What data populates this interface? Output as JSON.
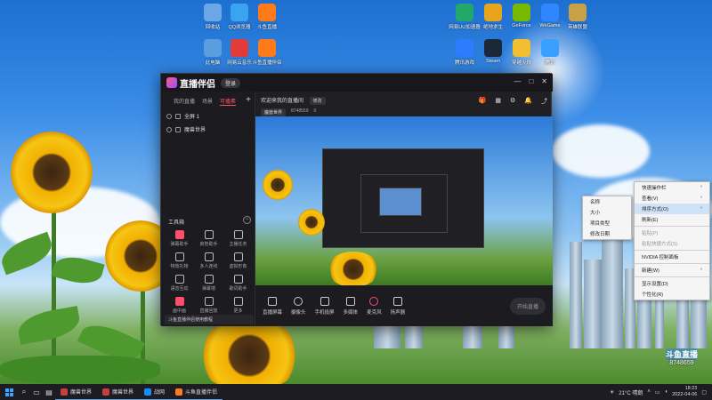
{
  "desktop": {
    "icons_left": [
      {
        "label": "回收站",
        "color": "#6ba6e6"
      },
      {
        "label": "QQ浏览器",
        "color": "#3ba4f0"
      },
      {
        "label": "斗鱼直播",
        "color": "#ff7a1a"
      },
      {
        "label": "此电脑",
        "color": "#5b9ee0"
      },
      {
        "label": "网易云音乐",
        "color": "#e33a3a"
      },
      {
        "label": "斗鱼直播伴侣",
        "color": "#ff7a1a"
      }
    ],
    "icons_right": [
      {
        "label": "网易UU加速器",
        "color": "#22a86a"
      },
      {
        "label": "绝地求生",
        "color": "#e6a51a"
      },
      {
        "label": "GeForce",
        "color": "#76b900"
      },
      {
        "label": "WeGame",
        "color": "#2f86ff"
      },
      {
        "label": "英雄联盟",
        "color": "#c8a046"
      },
      {
        "label": "腾讯游戏",
        "color": "#2b7cff"
      },
      {
        "label": "Steam",
        "color": "#1b2838"
      },
      {
        "label": "穿越火线",
        "color": "#f0c030"
      },
      {
        "label": "腾讯",
        "color": "#39a0ff"
      }
    ]
  },
  "app": {
    "name": "直播伴侣",
    "login": "登录",
    "window_controls": [
      "—",
      "□",
      "✕"
    ],
    "side_tabs": [
      "我的直播",
      "场景",
      "可播素"
    ],
    "active_side_tab": "可播素",
    "scenes": [
      "全屏 1",
      "魔兽世界"
    ],
    "tools_title": "工具箱",
    "tools": [
      {
        "label": "弹幕助手",
        "highlight": true
      },
      {
        "label": "房管助手",
        "highlight": false
      },
      {
        "label": "主播任务",
        "highlight": false
      },
      {
        "label": "特效礼物",
        "highlight": false
      },
      {
        "label": "多人连线",
        "highlight": false
      },
      {
        "label": "虚拟形象",
        "highlight": false
      },
      {
        "label": "语音互动",
        "highlight": false
      },
      {
        "label": "弹幕墙",
        "highlight": false
      },
      {
        "label": "歌词助手",
        "highlight": false
      },
      {
        "label": "画中画",
        "highlight": false
      },
      {
        "label": "直播回放",
        "highlight": false
      },
      {
        "label": "更多",
        "highlight": false
      }
    ],
    "banner": "斗鱼直播伴侣使用教程",
    "room_title": "欢迎来我的直播间",
    "change_label": "修改",
    "category": "魔兽世界",
    "room_id": "8748559",
    "fans_count": "0",
    "bottom_tools": [
      "直播屏幕",
      "摄像头",
      "手机投屏",
      "多媒体",
      "麦克风",
      "扬声器"
    ],
    "start_live": "开始直播"
  },
  "context_menu_main": [
    {
      "label": "快速操作栏",
      "arrow": true,
      "state": "normal"
    },
    {
      "label": "查看(V)",
      "arrow": true,
      "state": "normal"
    },
    {
      "label": "排序方式(O)",
      "arrow": true,
      "state": "highlight"
    },
    {
      "label": "刷新(E)",
      "arrow": false,
      "state": "normal"
    },
    {
      "label": "粘贴(P)",
      "arrow": false,
      "state": "disabled"
    },
    {
      "label": "粘贴快捷方式(S)",
      "arrow": false,
      "state": "disabled"
    },
    {
      "label": "NVIDIA 控制面板",
      "arrow": false,
      "state": "normal"
    },
    {
      "label": "新建(W)",
      "arrow": true,
      "state": "normal"
    },
    {
      "label": "显示设置(D)",
      "arrow": false,
      "state": "normal"
    },
    {
      "label": "个性化(R)",
      "arrow": false,
      "state": "normal"
    }
  ],
  "context_menu_sub": [
    "名称",
    "大小",
    "项目类型",
    "修改日期"
  ],
  "watermark": {
    "line1": "斗鱼直播",
    "line2": "8748659"
  },
  "taskbar": {
    "apps": [
      {
        "label": "魔兽世界",
        "color": "#c2413a"
      },
      {
        "label": "魔兽世界",
        "color": "#c2413a"
      },
      {
        "label": "战网",
        "color": "#148eff"
      },
      {
        "label": "斗鱼直播伴侣",
        "color": "#ff7a1a"
      }
    ],
    "weather": "21°C 晴朗",
    "time": "18:23",
    "date": "2022-04-06"
  }
}
